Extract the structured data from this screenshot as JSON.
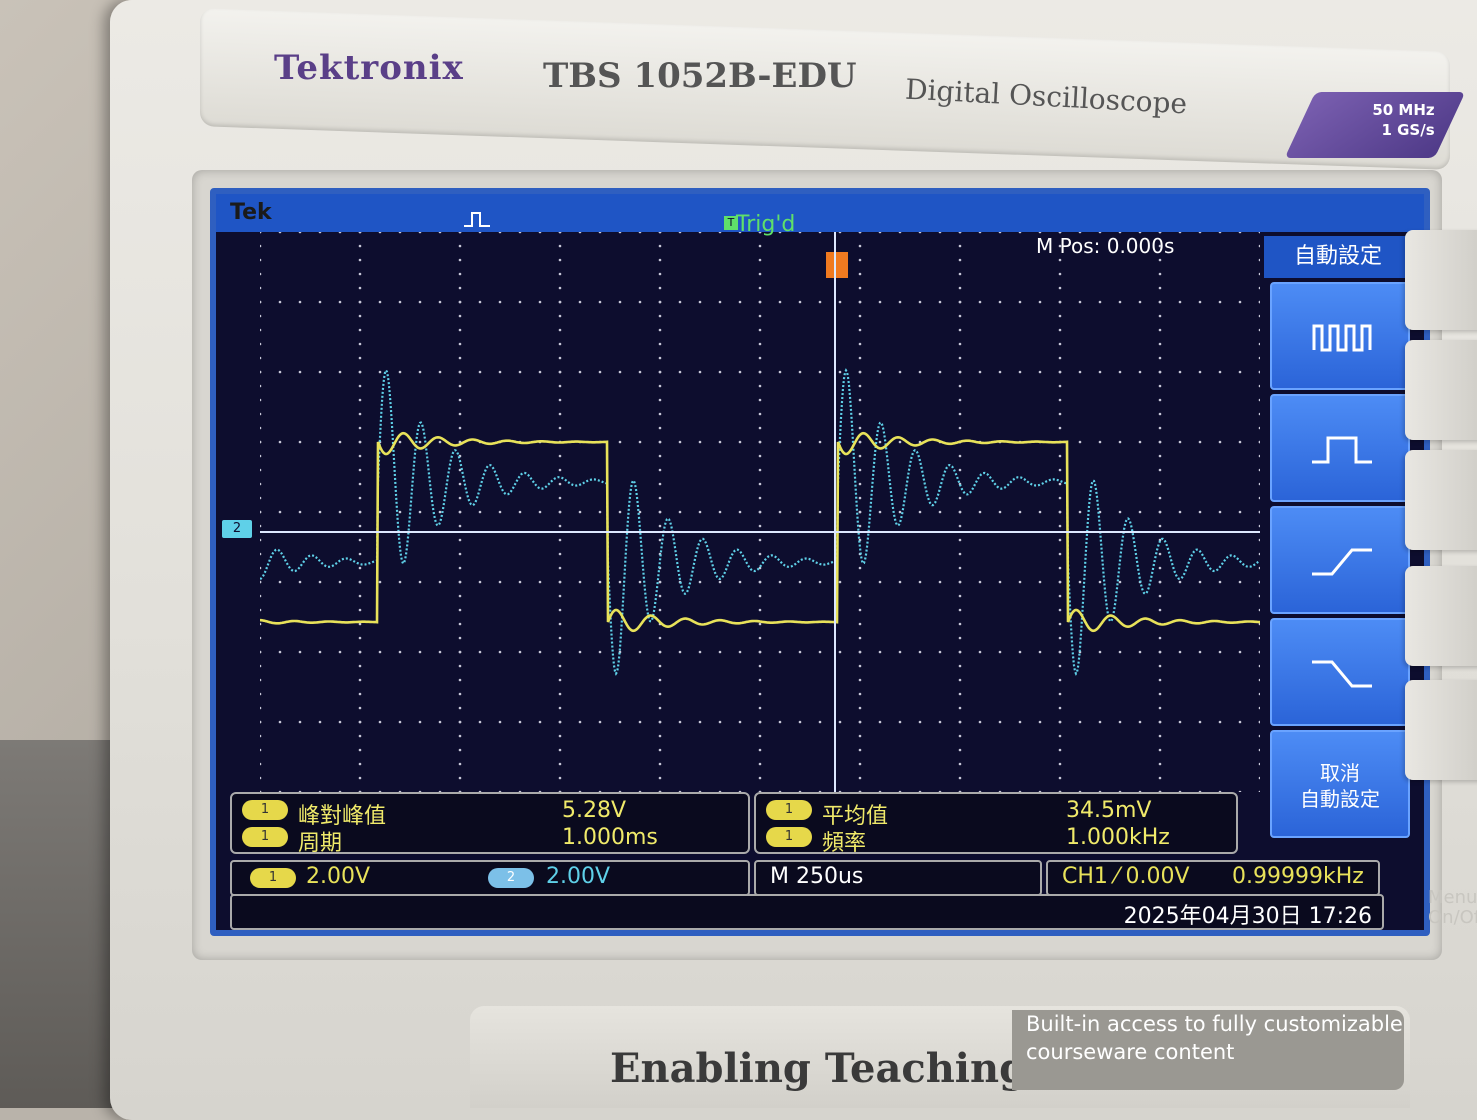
{
  "device": {
    "brand": "Tektronix",
    "model": "TBS 1052B-EDU",
    "description": "Digital Oscilloscope",
    "spec_bandwidth": "50 MHz",
    "spec_sample_rate": "1 GS/s",
    "tagline": "Enabling Teaching",
    "blurb_line1": "Built-in access to fully customizable",
    "blurb_line2": "courseware content",
    "menu_on_off": "Menu On/Off"
  },
  "screen": {
    "brand_tag": "Tek",
    "trigger_status": "Trig'd",
    "trigger_marker": "T",
    "m_pos": "M Pos: 0.000s",
    "ch2_marker": "2"
  },
  "side_menu": {
    "header": "自動設定",
    "buttons": [
      {
        "icon": "multi-cycle-wave-icon"
      },
      {
        "icon": "single-pulse-icon"
      },
      {
        "icon": "rising-edge-icon"
      },
      {
        "icon": "falling-edge-icon"
      }
    ],
    "cancel_line1": "取消",
    "cancel_line2": "自動設定"
  },
  "measurements": {
    "left": [
      {
        "channel": "1",
        "name": "峰對峰值",
        "value": "5.28V"
      },
      {
        "channel": "1",
        "name": "周期",
        "value": "1.000ms"
      }
    ],
    "right": [
      {
        "channel": "1",
        "name": "平均值",
        "value": "34.5mV"
      },
      {
        "channel": "1",
        "name": "頻率",
        "value": "1.000kHz"
      }
    ]
  },
  "status": {
    "ch1_channel": "1",
    "ch1_scale": "2.00V",
    "ch2_channel": "2",
    "ch2_scale": "2.00V",
    "timebase": "M 250us",
    "trigger": "CH1 ⁄ 0.00V",
    "trigger_freq": "0.99999kHz",
    "datetime": "2025年04月30日 17:26"
  },
  "colors": {
    "ch1": "#e8e25a",
    "ch2": "#5fd0e8",
    "screen_bg": "#0d0d2e",
    "menu_blue": "#2b64d8",
    "trig_green": "#5fe06a"
  }
}
